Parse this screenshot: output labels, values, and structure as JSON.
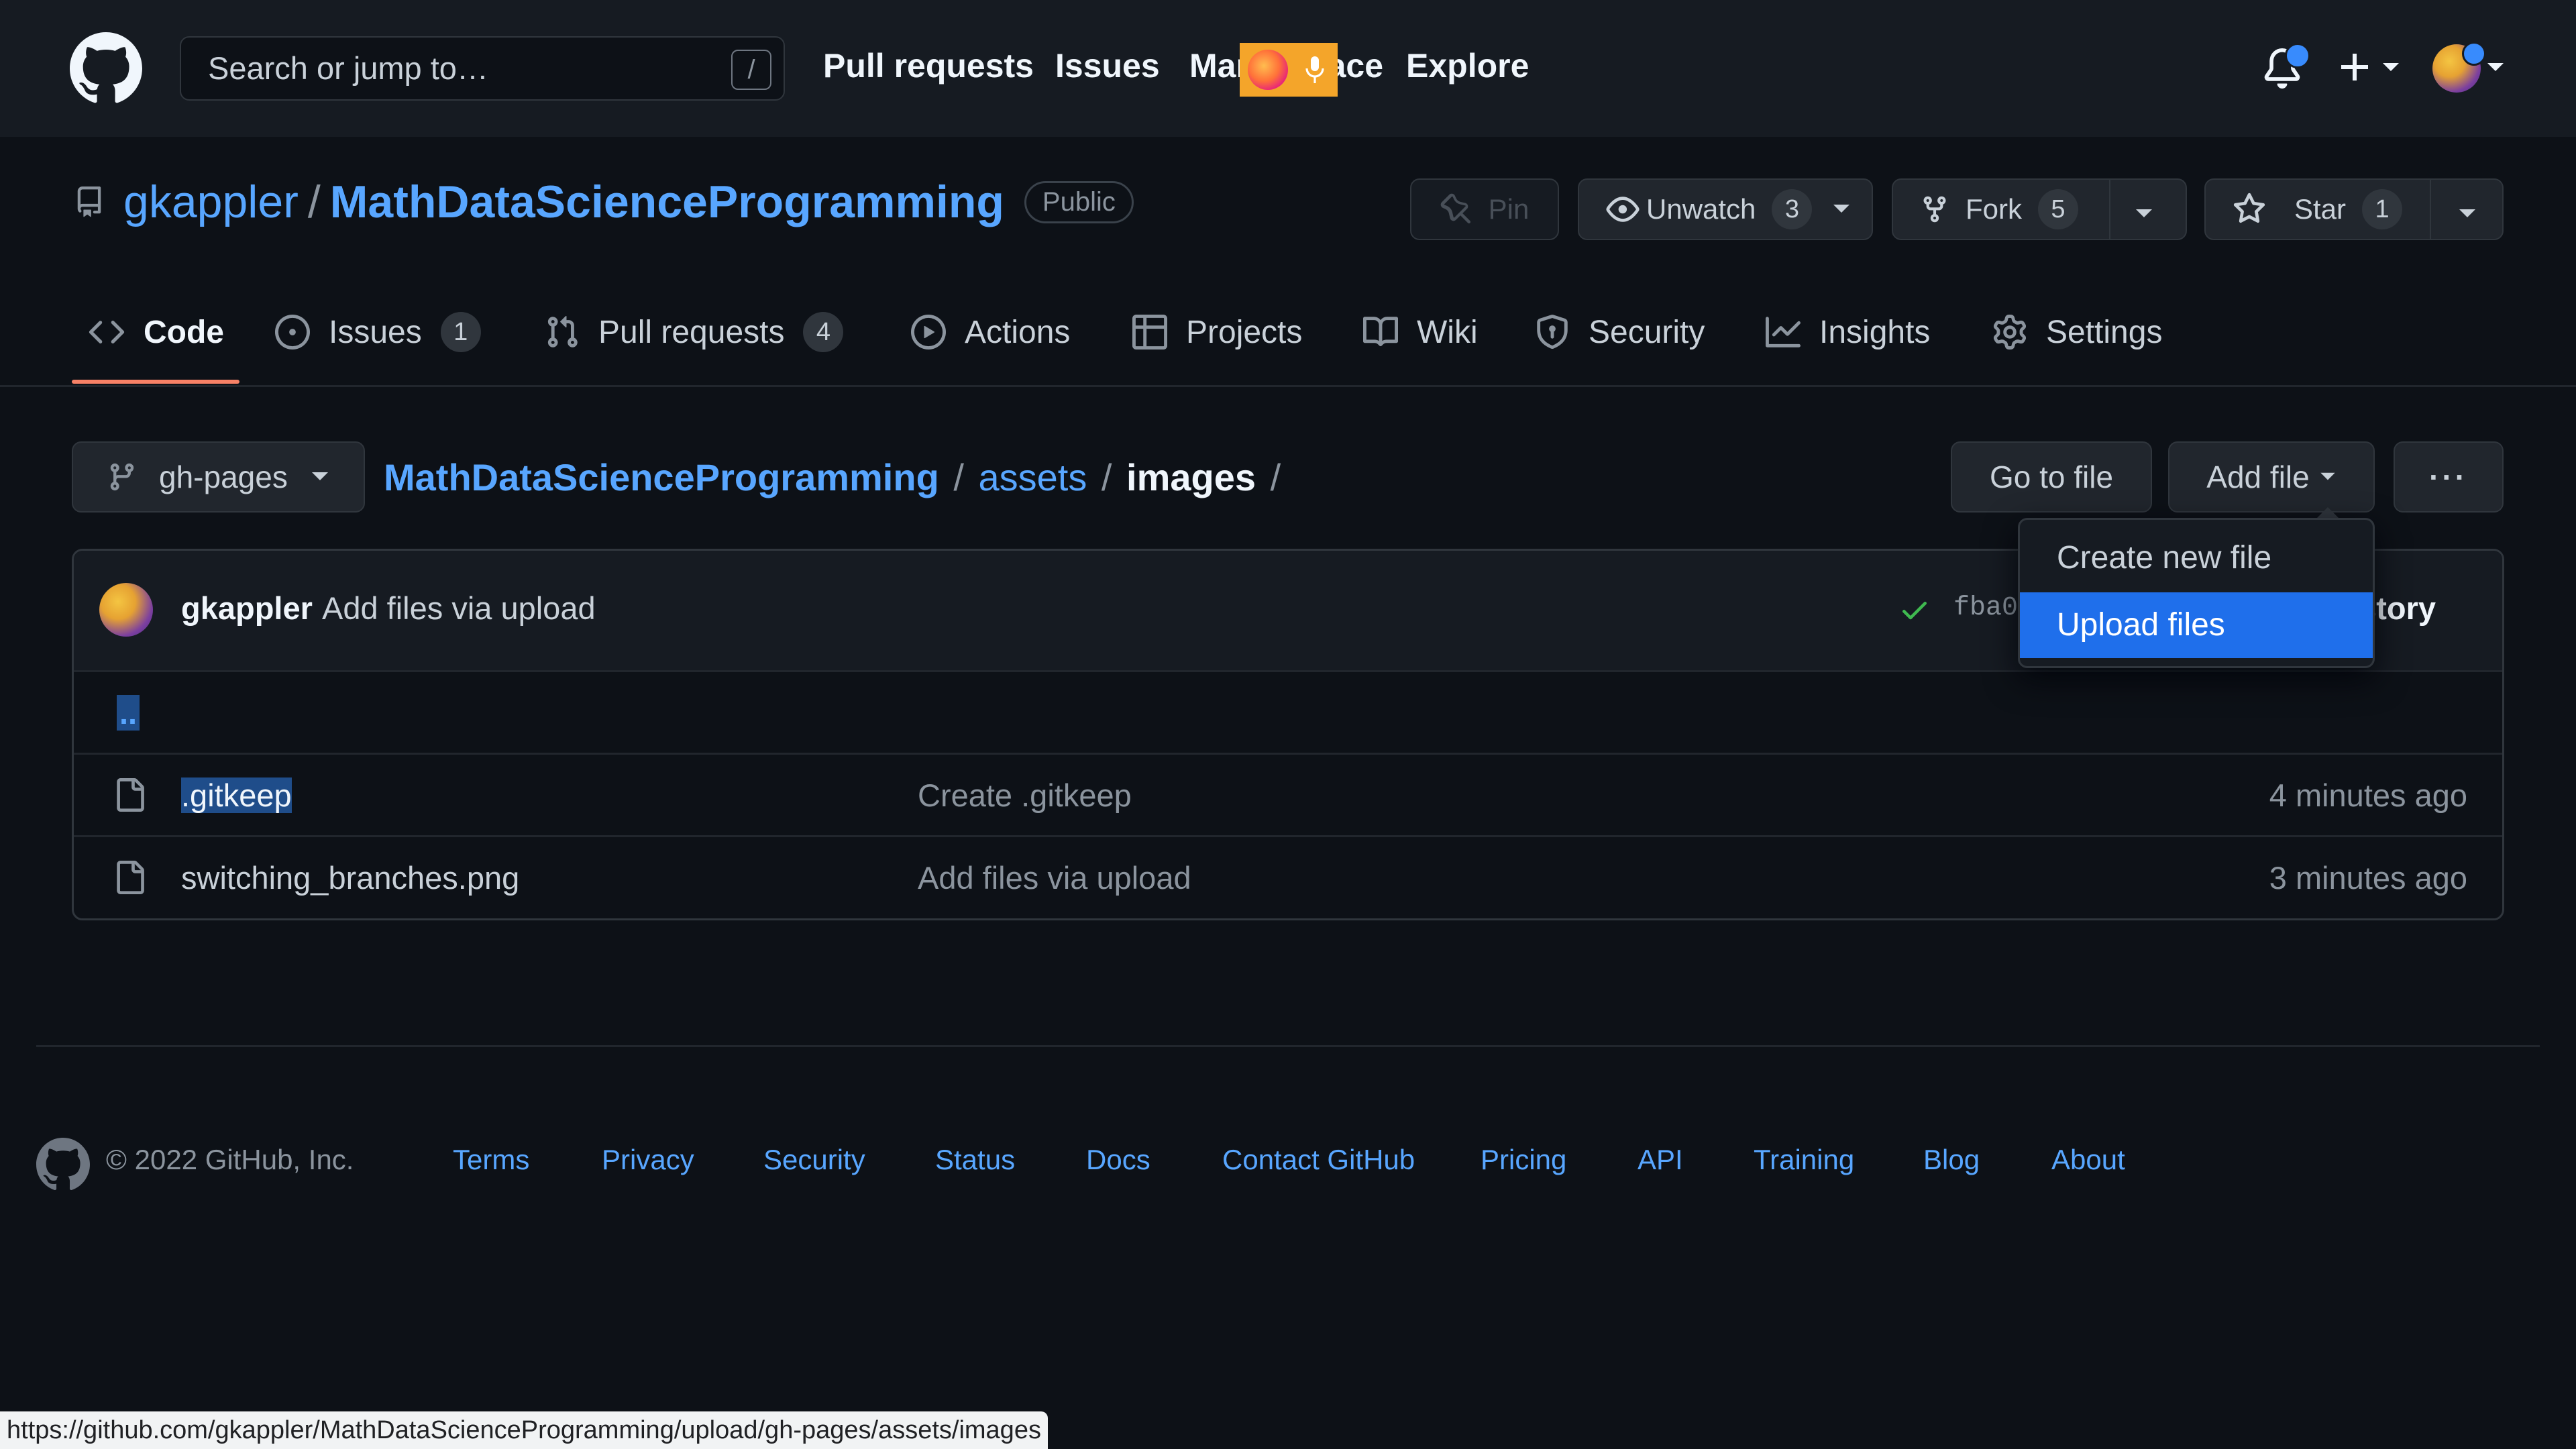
{
  "header": {
    "search_placeholder": "Search or jump to…",
    "search_shortcut": "/",
    "nav": [
      "Pull requests",
      "Issues",
      "Marketplace",
      "Explore"
    ]
  },
  "repo": {
    "owner": "gkappler",
    "separator": "/",
    "name": "MathDataScienceProgramming",
    "visibility": "Public",
    "pin_label": "Pin",
    "watch_label": "Unwatch",
    "watch_count": "3",
    "fork_label": "Fork",
    "fork_count": "5",
    "star_label": "Star",
    "star_count": "1"
  },
  "tabs": [
    {
      "label": "Code",
      "icon": "code-icon"
    },
    {
      "label": "Issues",
      "count": "1",
      "icon": "issue-icon"
    },
    {
      "label": "Pull requests",
      "count": "4",
      "icon": "pull-request-icon"
    },
    {
      "label": "Actions",
      "icon": "play-icon"
    },
    {
      "label": "Projects",
      "icon": "table-icon"
    },
    {
      "label": "Wiki",
      "icon": "book-icon"
    },
    {
      "label": "Security",
      "icon": "shield-icon"
    },
    {
      "label": "Insights",
      "icon": "graph-icon"
    },
    {
      "label": "Settings",
      "icon": "gear-icon"
    }
  ],
  "browser": {
    "branch": "gh-pages",
    "breadcrumb": {
      "root": "MathDataScienceProgramming",
      "sep": "/",
      "folder": "assets",
      "current": "images",
      "trailing": "/"
    },
    "go_to_file": "Go to file",
    "add_file": "Add file",
    "more": "···"
  },
  "add_file_menu": {
    "items": [
      "Create new file",
      "Upload files"
    ],
    "highlighted": "Upload files"
  },
  "latest_commit": {
    "author": "gkappler",
    "message": "Add files via upload",
    "sha_visible": "fba0",
    "history_visible": "listory"
  },
  "files": [
    {
      "name": "..",
      "type": "parent",
      "message": "",
      "time": ""
    },
    {
      "name": ".gitkeep",
      "type": "file",
      "message": "Create .gitkeep",
      "time": "4 minutes ago"
    },
    {
      "name": "switching_branches.png",
      "type": "file",
      "message": "Add files via upload",
      "time": "3 minutes ago"
    }
  ],
  "footer": {
    "copyright": "© 2022 GitHub, Inc.",
    "links": [
      "Terms",
      "Privacy",
      "Security",
      "Status",
      "Docs",
      "Contact GitHub",
      "Pricing",
      "API",
      "Training",
      "Blog",
      "About"
    ]
  },
  "status_url": "https://github.com/gkappler/MathDataScienceProgramming/upload/gh-pages/assets/images",
  "colors": {
    "background": "#0d1117",
    "header": "#161b22",
    "link": "#58a6ff",
    "tab_underline": "#f78166",
    "menu_highlight": "#1f6feb",
    "success": "#3fb950"
  }
}
